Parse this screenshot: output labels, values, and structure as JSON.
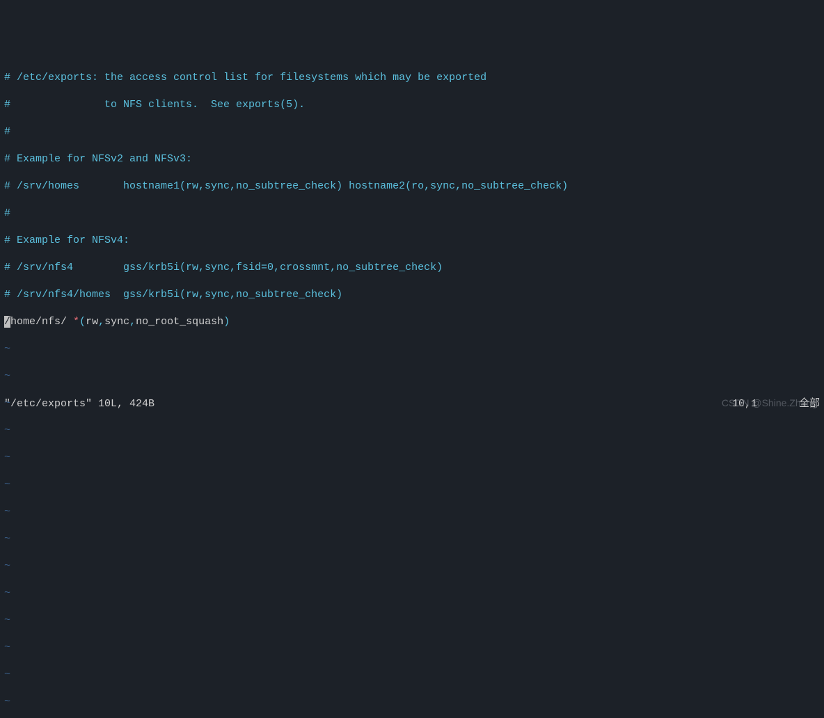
{
  "lines": {
    "l1": "# /etc/exports: the access control list for filesystems which may be exported",
    "l2": "#               to NFS clients.  See exports(5).",
    "l3": "#",
    "l4": "# Example for NFSv2 and NFSv3:",
    "l5": "# /srv/homes       hostname1(rw,sync,no_subtree_check) hostname2(ro,sync,no_subtree_check)",
    "l6": "#",
    "l7": "# Example for NFSv4:",
    "l8": "# /srv/nfs4        gss/krb5i(rw,sync,fsid=0,crossmnt,no_subtree_check)",
    "l9": "# /srv/nfs4/homes  gss/krb5i(rw,sync,no_subtree_check)"
  },
  "content": {
    "cursor_char": "/",
    "path_rest": "home/nfs/ ",
    "star": "*",
    "open": "(",
    "opt1": "rw",
    "c1": ",",
    "opt2": "sync",
    "c2": ",",
    "opt3": "no_root_squash",
    "close": ")"
  },
  "tilde": "~",
  "status": {
    "left": "\"/etc/exports\" 10L, 424B",
    "pos": "10,1",
    "scroll": "全部"
  },
  "watermark": "CSDN @Shine.Zhang"
}
